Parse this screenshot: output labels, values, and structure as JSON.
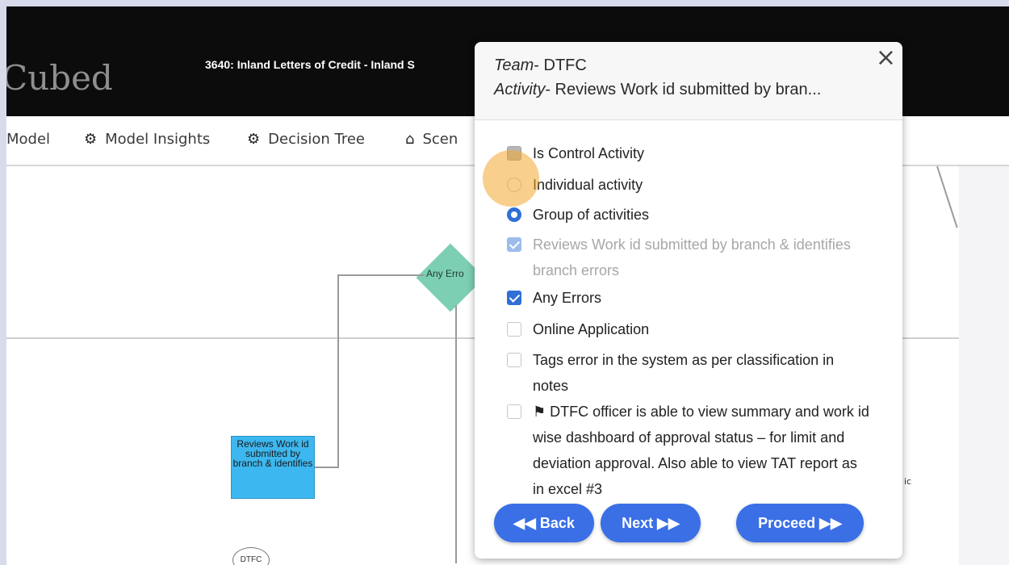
{
  "app": {
    "brand": "Cubed",
    "title": "3640: Inland Letters of Credit - Inland S"
  },
  "nav": {
    "items": [
      {
        "label": "Model",
        "icon": ""
      },
      {
        "label": "Model Insights",
        "icon": "globe-icon"
      },
      {
        "label": "Decision Tree",
        "icon": "gears-icon"
      },
      {
        "label": "Scen",
        "icon": "hierarchy-icon"
      }
    ]
  },
  "diagram": {
    "diamond_label": "Any Erro",
    "box_label": "Reviews Work id submitted by branch & identifies",
    "oval_label": "DTFC",
    "fragment": "ic"
  },
  "popup": {
    "team_prefix": "Team",
    "team_value": "- DTFC",
    "activity_prefix": "Activity",
    "activity_value": "- Reviews Work id submitted by bran...",
    "options": [
      {
        "label": "Is Control Activity",
        "state": "gray"
      },
      {
        "label": "Individual activity",
        "state": "radio-off"
      },
      {
        "label": "Group of activities",
        "state": "radio-on"
      },
      {
        "label": "Reviews Work id submitted by branch & identifies branch errors",
        "state": "disabled-checked"
      },
      {
        "label": "Any Errors",
        "state": "checked"
      },
      {
        "label": "Online Application",
        "state": "unchecked"
      },
      {
        "label": "Tags error in the system as per classification in notes",
        "state": "unchecked"
      },
      {
        "label": "⚑ DTFC officer is able to view summary and work id wise dashboard of approval status – for limit and deviation approval. Also able to view TAT report as in excel #3",
        "state": "unchecked"
      }
    ],
    "buttons": {
      "back": "◀◀ Back",
      "next": "Next ▶▶",
      "proceed": "Proceed ▶▶"
    }
  }
}
